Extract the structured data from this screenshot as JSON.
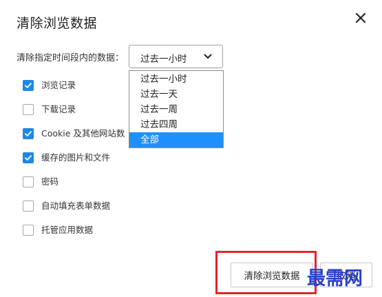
{
  "dialog": {
    "title": "清除浏览数据",
    "close_icon": "close-icon"
  },
  "time_range": {
    "label": "清除指定时间段内的数据：",
    "selected_value": "过去一小时",
    "options": [
      {
        "label": "过去一小时",
        "selected": false
      },
      {
        "label": "过去一天",
        "selected": false
      },
      {
        "label": "过去一周",
        "selected": false
      },
      {
        "label": "过去四周",
        "selected": false
      },
      {
        "label": "全部",
        "selected": true
      }
    ]
  },
  "data_types": [
    {
      "label": "浏览记录",
      "checked": true
    },
    {
      "label": "下载记录",
      "checked": false
    },
    {
      "label": "Cookie 及其他网站数",
      "checked": true
    },
    {
      "label": "缓存的图片和文件",
      "checked": true
    },
    {
      "label": "密码",
      "checked": false
    },
    {
      "label": "自动填充表单数据",
      "checked": false
    },
    {
      "label": "托管应用数据",
      "checked": false
    }
  ],
  "footer": {
    "clear_label": "清除浏览数据",
    "cancel_label": "取消"
  },
  "watermark": "最需网",
  "colors": {
    "accent": "#1e88e5",
    "dropdown_selected": "#1e90ff",
    "highlight": "#e0262b",
    "watermark": "#2a40c8"
  }
}
